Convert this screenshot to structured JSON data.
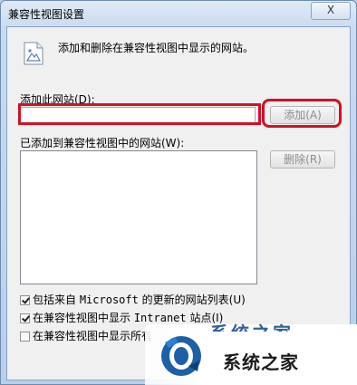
{
  "window": {
    "title": "兼容性视图设置",
    "close_label": "X"
  },
  "description": "添加和删除在兼容性视图中显示的网站。",
  "add_site": {
    "label": "添加此网站(D):",
    "value": "",
    "button_label": "添加(A)"
  },
  "site_list": {
    "label": "已添加到兼容性视图中的网站(W):",
    "items": [],
    "remove_label": "删除(R)"
  },
  "options": [
    {
      "pre": "包括来自 ",
      "mono": "Microsoft",
      "post": " 的更新的网站列表(U)",
      "checked": true
    },
    {
      "pre": "在兼容性视图中显示 ",
      "mono": "Intranet",
      "post": " 站点(I)",
      "checked": true
    },
    {
      "pre": "在兼容性视图中显示所有",
      "mono": "",
      "post": "",
      "checked": false
    }
  ],
  "watermark": {
    "text": "系统之家",
    "faint_text": "系统之家"
  },
  "colors": {
    "highlight_red": "#d2102a",
    "title_gradient_top": "#dfeaf7",
    "client_bg": "#f0f0f0"
  },
  "icons": {
    "page": "document-image-icon",
    "close": "close-icon",
    "logo": "watermark-logo-icon"
  }
}
